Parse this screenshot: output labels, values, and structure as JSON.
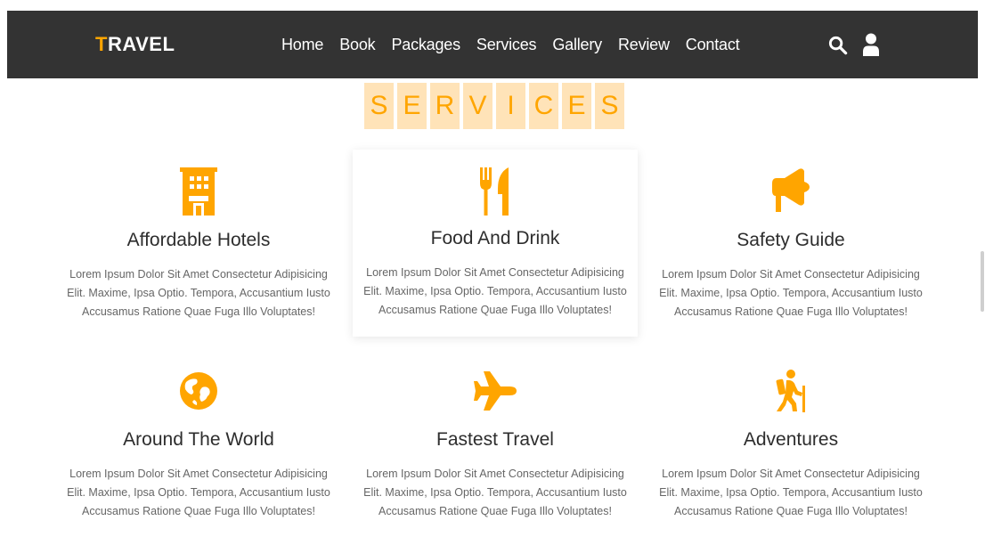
{
  "header": {
    "logo_first": "T",
    "logo_rest": "RAVEL",
    "nav": [
      "Home",
      "Book",
      "Packages",
      "Services",
      "Gallery",
      "Review",
      "Contact"
    ],
    "icons": [
      "search-icon",
      "user-icon"
    ]
  },
  "section": {
    "heading_letters": [
      "S",
      "E",
      "R",
      "V",
      "I",
      "C",
      "E",
      "S"
    ]
  },
  "services": [
    {
      "icon": "hotel-icon",
      "title": "Affordable Hotels",
      "text": "Lorem Ipsum Dolor Sit Amet Consectetur Adipisicing Elit. Maxime, Ipsa Optio. Tempora, Accusantium Iusto Accusamus Ratione Quae Fuga Illo Voluptates!"
    },
    {
      "icon": "utensils-icon",
      "title": "Food And Drink",
      "text": "Lorem Ipsum Dolor Sit Amet Consectetur Adipisicing Elit. Maxime, Ipsa Optio. Tempora, Accusantium Iusto Accusamus Ratione Quae Fuga Illo Voluptates!"
    },
    {
      "icon": "bullhorn-icon",
      "title": "Safety Guide",
      "text": "Lorem Ipsum Dolor Sit Amet Consectetur Adipisicing Elit. Maxime, Ipsa Optio. Tempora, Accusantium Iusto Accusamus Ratione Quae Fuga Illo Voluptates!"
    },
    {
      "icon": "globe-icon",
      "title": "Around The World",
      "text": "Lorem Ipsum Dolor Sit Amet Consectetur Adipisicing Elit. Maxime, Ipsa Optio. Tempora, Accusantium Iusto Accusamus Ratione Quae Fuga Illo Voluptates!"
    },
    {
      "icon": "plane-icon",
      "title": "Fastest Travel",
      "text": "Lorem Ipsum Dolor Sit Amet Consectetur Adipisicing Elit. Maxime, Ipsa Optio. Tempora, Accusantium Iusto Accusamus Ratione Quae Fuga Illo Voluptates!"
    },
    {
      "icon": "hiking-icon",
      "title": "Adventures",
      "text": "Lorem Ipsum Dolor Sit Amet Consectetur Adipisicing Elit. Maxime, Ipsa Optio. Tempora, Accusantium Iusto Accusamus Ratione Quae Fuga Illo Voluptates!"
    }
  ],
  "colors": {
    "accent": "#ffa500",
    "accent_light": "#ffe3b8",
    "nav_background": "#333333"
  }
}
